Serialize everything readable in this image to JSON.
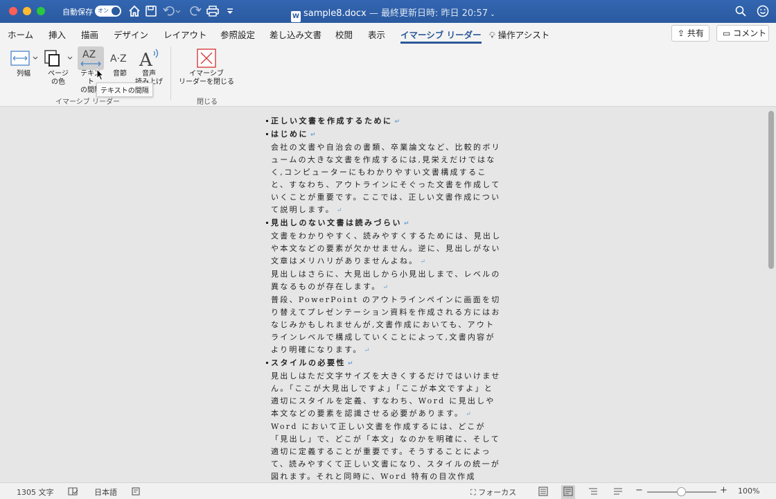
{
  "titlebar": {
    "autosave_label": "自動保存",
    "autosave_toggle": "オン",
    "doc_name": "sample8.docx",
    "doc_subtitle": " — 最終更新日時: 昨日 20:57",
    "icons": [
      "home-icon",
      "save-icon",
      "undo-icon",
      "redo-icon",
      "print-icon",
      "customize-icon",
      "search-icon",
      "smiley-icon"
    ]
  },
  "tabs": [
    "ホーム",
    "挿入",
    "描画",
    "デザイン",
    "レイアウト",
    "参照設定",
    "差し込み文書",
    "校閲",
    "表示",
    "イマーシブ リーダー",
    "操作アシスト"
  ],
  "active_tab": "イマーシブ リーダー",
  "share_label": "共有",
  "comment_label": "コメント",
  "ribbon": {
    "column_width": "列幅",
    "page_color_1": "ページ",
    "page_color_2": "の色",
    "text_spacing_1": "テキスト",
    "text_spacing_2": "の間隔",
    "syllables": "音節",
    "read_aloud_1": "音声",
    "read_aloud_2": "読み上げ",
    "close_1": "イマーシブ",
    "close_2": "リーダーを閉じる",
    "group_immersive": "イマーシブ リーダー",
    "group_close": "閉じる",
    "tooltip": "テキストの間隔"
  },
  "document": {
    "paragraphs": [
      {
        "type": "heading",
        "text": "正しい文書を作成するために"
      },
      {
        "type": "heading",
        "text": "はじめに"
      },
      {
        "type": "body",
        "text": "会社の文書や自治会の書類、卒業論文など、比較的ボリュームの大きな文書を作成するには,見栄えだけではなく,コンピューターにもわかりやすい文書構成すること、すなわち、アウトラインにそぐった文書を作成していくことが重要です。ここでは、正しい文書作成について説明します。"
      },
      {
        "type": "heading",
        "text": "見出しのない文書は読みづらい"
      },
      {
        "type": "body",
        "text": "文書をわかりやすく、読みやすくするためには、見出しや本文などの要素が欠かせません。逆に、見出しがない文章はメリハリがありませんよね。"
      },
      {
        "type": "body",
        "text": "見出しはさらに、大見出しから小見出しまで、レベルの異なるものが存在します。"
      },
      {
        "type": "body",
        "text": "普段、PowerPoint のアウトラインペインに画面を切り替えてプレゼンテーション資料を作成される方にはおなじみかもしれませんが,文書作成においても、アウトラインレベルで構成していくことによって,文書内容がより明確になります。"
      },
      {
        "type": "heading",
        "text": "スタイルの必要性"
      },
      {
        "type": "body",
        "text": "見出しはただ文字サイズを大きくするだけではいけません。「ここが大見出しですよ」「ここが本文ですよ」と適切にスタイルを定義、すなわち、Word に見出しや本文などの要素を認識させる必要があります。"
      },
      {
        "type": "body",
        "text": "Word において正しい文書を作成するには、どこが「見出し」で、どこが「本文」なのかを明確に、そして適切に定義することが重要です。そうすることによって、読みやすくて正しい文書になり、スタイルの統一が図れます。それと同時に、Word 特有の目次作成"
      }
    ]
  },
  "statusbar": {
    "word_count": "1305 文字",
    "language": "日本語",
    "focus": "フォーカス",
    "zoom": "100%",
    "zoom_level": 0.5
  }
}
